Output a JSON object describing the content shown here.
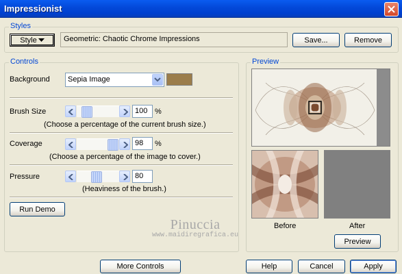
{
  "window": {
    "title": "Impressionist"
  },
  "styles": {
    "legend": "Styles",
    "style_button": "Style",
    "preset_name": "Geometric: Chaotic Chrome Impressions",
    "save_label": "Save...",
    "remove_label": "Remove"
  },
  "controls": {
    "legend": "Controls",
    "background": {
      "label": "Background",
      "value": "Sepia Image",
      "swatch_color": "#9b7d4b"
    },
    "brush_size": {
      "label": "Brush Size",
      "value": "100",
      "unit": "%",
      "hint": "(Choose a percentage of the current brush size.)",
      "level": 0.15
    },
    "coverage": {
      "label": "Coverage",
      "value": "98",
      "unit": "%",
      "hint": "(Choose a percentage of the image to cover.)",
      "level": 0.98
    },
    "pressure": {
      "label": "Pressure",
      "value": "80",
      "hint": "(Heaviness of the brush.)",
      "level": 0.45
    },
    "run_demo_label": "Run Demo"
  },
  "preview": {
    "legend": "Preview",
    "before_label": "Before",
    "after_label": "After",
    "preview_button": "Preview"
  },
  "watermark": {
    "name": "Pinuccia",
    "url": "www.maidiregrafica.eu"
  },
  "footer": {
    "more_controls": "More Controls",
    "help": "Help",
    "cancel": "Cancel",
    "apply": "Apply"
  },
  "colors": {
    "accent": "#0046d5",
    "titlebar": "#0348d8",
    "after_preview": "#808080"
  }
}
